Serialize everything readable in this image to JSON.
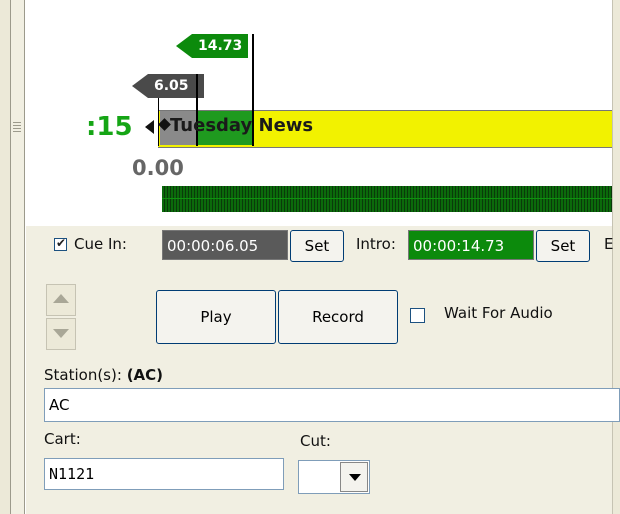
{
  "markers": {
    "intro_flag": "14.73",
    "cue_in_flag": "6.05"
  },
  "track": {
    "title": "Tuesday News",
    "countdown": ":15",
    "position": "0.00"
  },
  "cue_controls": {
    "cue_in_checked": true,
    "cue_in_label": "Cue In:",
    "cue_in_time": "00:00:06.05",
    "cue_in_set": "Set",
    "intro_label": "Intro:",
    "intro_time": "00:00:14.73",
    "intro_set": "Set",
    "truncated_label": "E"
  },
  "transport": {
    "play": "Play",
    "record": "Record",
    "wait_for_audio_label": "Wait For Audio",
    "wait_for_audio_checked": false
  },
  "stations": {
    "label": "Station(s):",
    "value_bold": "(AC)",
    "field": "AC"
  },
  "cart": {
    "label": "Cart:",
    "value": "N1121"
  },
  "cut": {
    "label": "Cut:",
    "value": ""
  },
  "colors": {
    "intro_green": "#0c8a0c",
    "cue_in_gray": "#4a4a4a",
    "track_yellow": "#f2f200",
    "countdown_green": "#15a515",
    "meter_green": "#0b6a0b"
  }
}
